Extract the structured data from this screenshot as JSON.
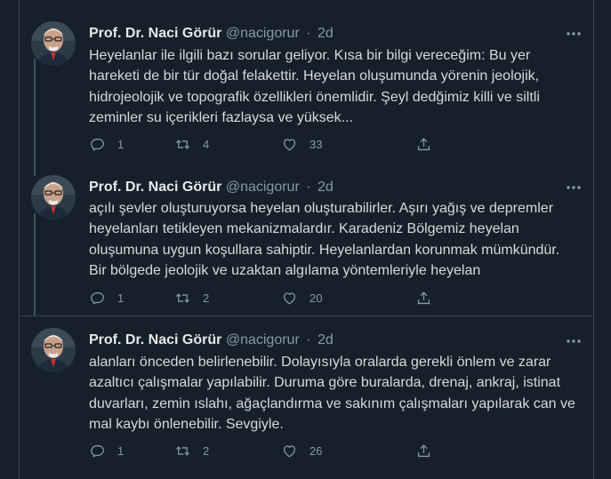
{
  "tweets": [
    {
      "name": "Prof. Dr. Naci Görür",
      "handle": "@nacigorur",
      "separator": "·",
      "time": "2d",
      "lines": [
        "Heyelanlar ile ilgili bazı sorular geliyor. Kısa bir bilgi vereceğim: Bu yer",
        "hareketi de bir tür doğal felakettir. Heyelan oluşumunda yörenin jeolojik,",
        "hidrojeolojik ve topografik özellikleri önemlidir. Şeyl dedğimiz killi ve siltli",
        "zeminler su içerikleri fazlaysa ve yüksek..."
      ],
      "replies": "1",
      "retweets": "4",
      "likes": "33"
    },
    {
      "name": "Prof. Dr. Naci Görür",
      "handle": "@nacigorur",
      "separator": "·",
      "time": "2d",
      "lines": [
        "açılı şevler oluşturuyorsa heyelan oluşturabilirler. Aşırı yağış ve depremler",
        "heyelanları tetikleyen mekanizmalardır. Karadeniz Bölgemiz heyelan",
        "oluşumuna uygun koşullara sahiptir. Heyelanlardan korunmak mümkündür.",
        "Bir bölgede jeolojik ve uzaktan algılama yöntemleriyle heyelan"
      ],
      "replies": "1",
      "retweets": "2",
      "likes": "20"
    },
    {
      "name": "Prof. Dr. Naci Görür",
      "handle": "@nacigorur",
      "separator": "·",
      "time": "2d",
      "lines": [
        "alanları önceden belirlenebilir. Dolayısıyla oralarda gerekli önlem ve zarar",
        "azaltıcı çalışmalar yapılabilir. Duruma göre buralarda, drenaj, ankraj, istinat",
        "duvarları, zemin ıslahı, ağaçlandırma ve sakınım çalışmaları yapılarak can ve",
        "mal kaybı önlenebilir. Sevgiyle."
      ],
      "replies": "1",
      "retweets": "2",
      "likes": "26"
    }
  ],
  "icons": {
    "reply": "reply-icon",
    "retweet": "retweet-icon",
    "like": "like-icon",
    "share": "share-icon",
    "more": "more-icon"
  },
  "colors": {
    "background": "#15202b",
    "text": "#d9d9d9",
    "muted": "#8899a6",
    "divider": "#38444d"
  }
}
